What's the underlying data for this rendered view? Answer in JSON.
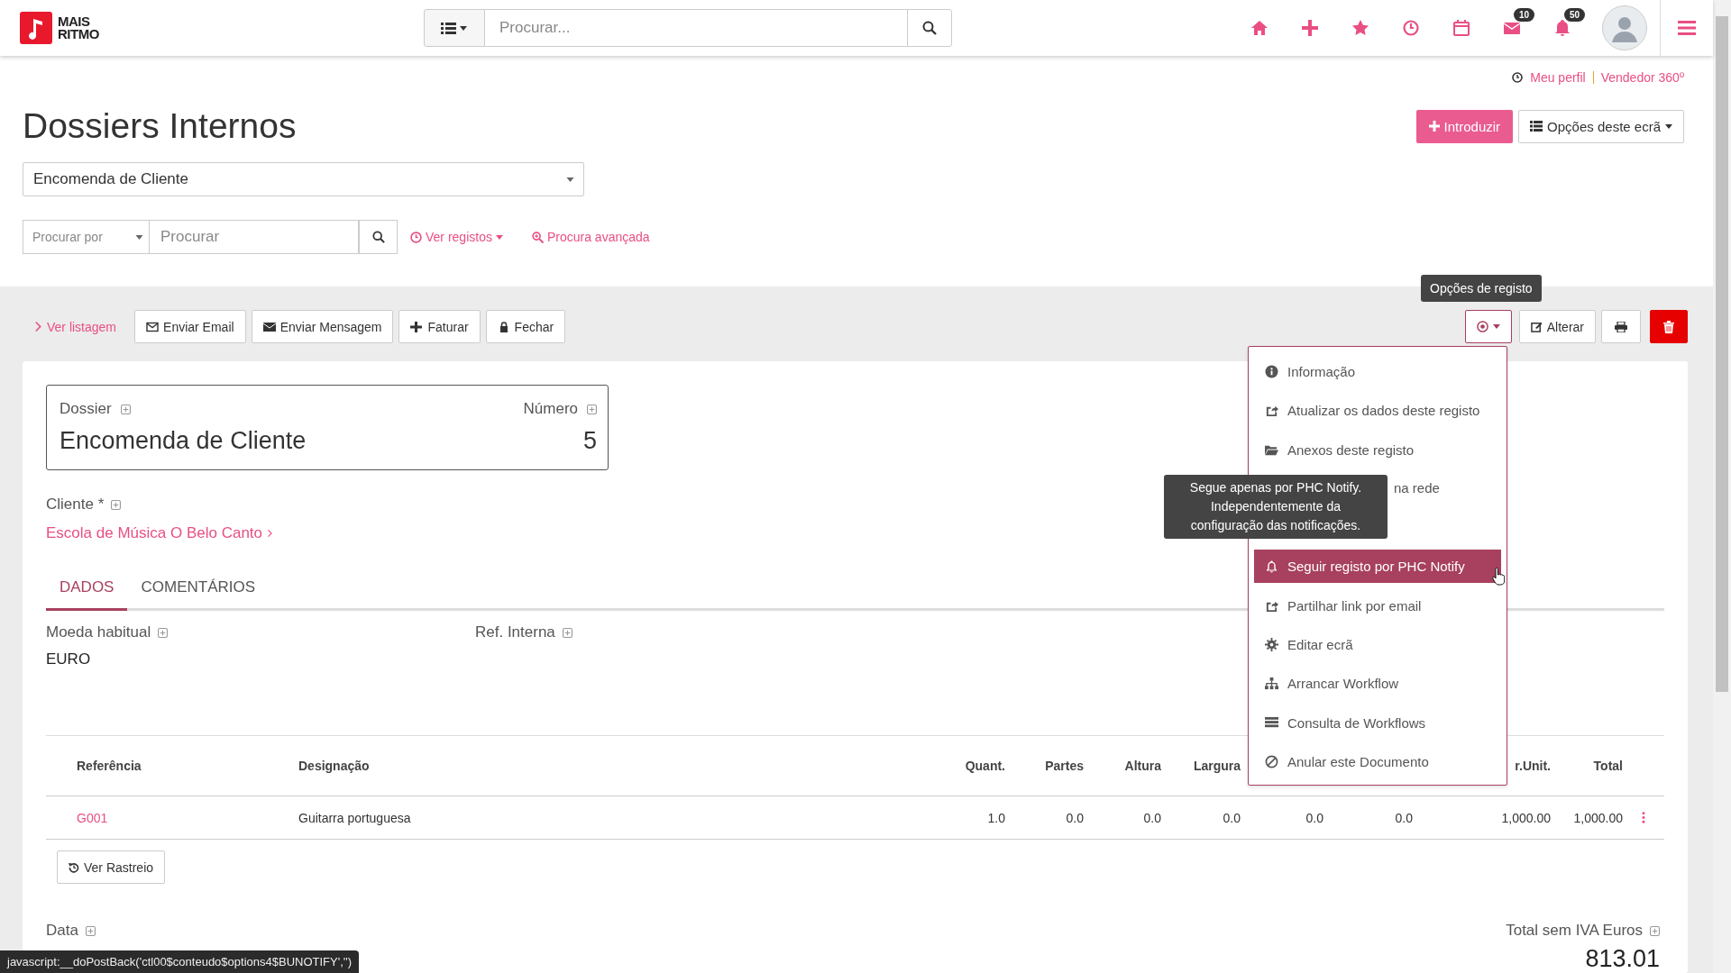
{
  "header": {
    "logo": [
      "MAIS",
      "RITMO"
    ],
    "search": {
      "placeholder": "Procurar..."
    },
    "nav_icons": [
      {
        "kind": "home"
      },
      {
        "kind": "plus"
      },
      {
        "kind": "star"
      },
      {
        "kind": "clock"
      },
      {
        "kind": "calendar"
      },
      {
        "kind": "envelope",
        "badge": "10"
      },
      {
        "kind": "bell",
        "badge": "50"
      }
    ]
  },
  "user_links": [
    "Meu perfil",
    "Vendedor 360º"
  ],
  "page_title": "Dossiers Internos",
  "page_buttons": {
    "primary": "Introduzir",
    "options": "Opções deste ecrã"
  },
  "doc_type_select": {
    "value": "Encomenda de Cliente"
  },
  "filter": {
    "field_select": {
      "placeholder": "Procurar por"
    },
    "search": {
      "placeholder": "Procurar"
    },
    "view_link": "Ver registos",
    "advanced_link": "Procura avançada"
  },
  "toolbar": {
    "back_link": "Ver listagem",
    "actions": [
      {
        "kind": "envelope-outline",
        "label": "Enviar Email"
      },
      {
        "kind": "envelope",
        "label": "Enviar Mensagem"
      },
      {
        "kind": "plus",
        "label": "Faturar"
      },
      {
        "kind": "lock",
        "label": "Fechar"
      }
    ],
    "options_tooltip": "Opções de registo",
    "edit_button": "Alterar"
  },
  "record": {
    "dossier_label": "Dossier",
    "dossier_value": "Encomenda de Cliente",
    "number_label": "Número",
    "number_value": "5",
    "client_label": "Cliente *",
    "client_value": "Escola de Música O Belo Canto"
  },
  "tabs": [
    {
      "label": "DADOS",
      "selected": true
    },
    {
      "label": "COMENTÁRIOS",
      "selected": false
    }
  ],
  "fields": [
    {
      "label": "Moeda habitual",
      "value": "EURO"
    },
    {
      "label": "Ref. Interna"
    }
  ],
  "table": {
    "columns": [
      {
        "label": "Referência"
      },
      {
        "label": "Designação"
      },
      {
        "label": "Quant."
      },
      {
        "label": "Partes"
      },
      {
        "label": "Altura"
      },
      {
        "label": "Largura"
      },
      {},
      {},
      {
        "label": "r.Unit."
      },
      {
        "label": "Total"
      }
    ],
    "rows": [
      {
        "cells": [
          "G001",
          "Guitarra portuguesa",
          "1.0",
          "0.0",
          "0.0",
          "0.0",
          "0.0",
          "0.0",
          "1,000.00",
          "1,000.00"
        ]
      }
    ]
  },
  "trace_button": "Ver Rastreio",
  "totals": {
    "date_label": "Data",
    "total_label": "Total sem IVA Euros",
    "total_value": "813.01"
  },
  "menu": {
    "items": [
      {
        "kind": "info",
        "label": "Informação",
        "selected": false
      },
      {
        "kind": "share",
        "label": "Atualizar os dados deste registo",
        "selected": false
      },
      {
        "kind": "folder",
        "label": "Anexos deste registo",
        "selected": false
      },
      {
        "kind": "covered",
        "label": "na rede",
        "selected": false
      },
      {
        "kind": "bell",
        "label": "Seguir registo por PHC Notify",
        "selected": true
      },
      {
        "kind": "share",
        "label": "Partilhar link por email",
        "selected": false
      },
      {
        "kind": "gear",
        "label": "Editar ecrã",
        "selected": false
      },
      {
        "kind": "hierarchy",
        "label": "Arrancar Workflow",
        "selected": false
      },
      {
        "kind": "list",
        "label": "Consulta de Workflows",
        "selected": false
      },
      {
        "kind": "ban",
        "label": "Anular este Documento",
        "selected": false
      }
    ]
  },
  "menu_tooltip": "Segue apenas por PHC Notify. Independentemente da configuração das notificações.",
  "status_bar": "javascript:__doPostBack('ctl00$conteudo$options4$BUNOTIFY','')"
}
